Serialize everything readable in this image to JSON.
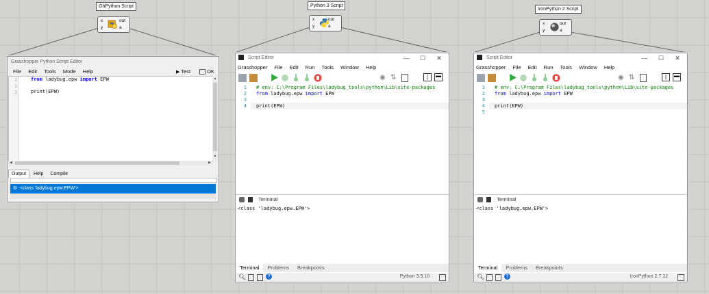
{
  "canvas": {
    "components": [
      {
        "title": "GhPython Script",
        "inputs": [
          "x",
          "y"
        ],
        "outputs": [
          "out",
          "a"
        ],
        "icon": "ghpython-icon"
      },
      {
        "title": "Python 3 Script",
        "inputs": [
          "x",
          "y"
        ],
        "outputs": [
          "out",
          "a"
        ],
        "icon": "python3-icon"
      },
      {
        "title": "IronPython 2 Script",
        "inputs": [
          "x",
          "y"
        ],
        "outputs": [
          "out",
          "a"
        ],
        "icon": "ironpython-icon"
      }
    ]
  },
  "gh_editor": {
    "title": "Grasshopper Python Script Editor",
    "menu": [
      "File",
      "Edit",
      "Tools",
      "Mode",
      "Help"
    ],
    "test_label": "Test",
    "ok_label": "OK",
    "line_numbers": [
      "1",
      "2",
      "3"
    ],
    "code": {
      "l1_from": "from",
      "l1_mod": " ladybug.epw ",
      "l1_import": "import",
      "l1_name": " EPW",
      "l3": "print(EPW)"
    },
    "tabs": [
      "Output",
      "Help",
      "Compile"
    ],
    "output_text": "<class 'ladybug.epw.EPW'>"
  },
  "py3_editor": {
    "title": "Script Editor",
    "menu": [
      "Grasshopper",
      "File",
      "Edit",
      "Run",
      "Tools",
      "Window",
      "Help"
    ],
    "line_numbers": [
      "1",
      "2",
      "3",
      "4"
    ],
    "code": {
      "l1": "# env: C:\\Program Files\\ladybug_tools\\python\\Lib\\site-packages",
      "l2_from": "from",
      "l2_mod": " ladybug.epw ",
      "l2_import": "import",
      "l2_name": " EPW",
      "l4": "print(EPW)"
    },
    "terminal_label": "Terminal",
    "terminal_output": "<class 'ladybug.epw.EPW'>",
    "bottom_tabs": [
      "Terminal",
      "Problems",
      "Breakpoints"
    ],
    "runtime": "Python 3.9.10"
  },
  "iron_editor": {
    "title": "Script Editor",
    "menu": [
      "Grasshopper",
      "File",
      "Edit",
      "Run",
      "Tools",
      "Window",
      "Help"
    ],
    "line_numbers": [
      "1",
      "2",
      "3",
      "4",
      "5"
    ],
    "code": {
      "l1": "# env: C:\\Program Files\\ladybug_tools\\python\\Lib\\site-packages",
      "l2_from": "from",
      "l2_mod": " ladybug.epw ",
      "l2_import": "import",
      "l2_name": " EPW",
      "l4": "print(EPW)"
    },
    "terminal_label": "Terminal",
    "terminal_output": "<class 'ladybug.epw.EPW'>",
    "bottom_tabs": [
      "Terminal",
      "Problems",
      "Breakpoints"
    ],
    "runtime": "IronPython 2.7.12"
  },
  "colors": {
    "selection": "#0078d7",
    "keyword": "#0000ff",
    "comment": "#008000",
    "run_green": "#2eaa3c",
    "stop_red": "#e8453c"
  }
}
